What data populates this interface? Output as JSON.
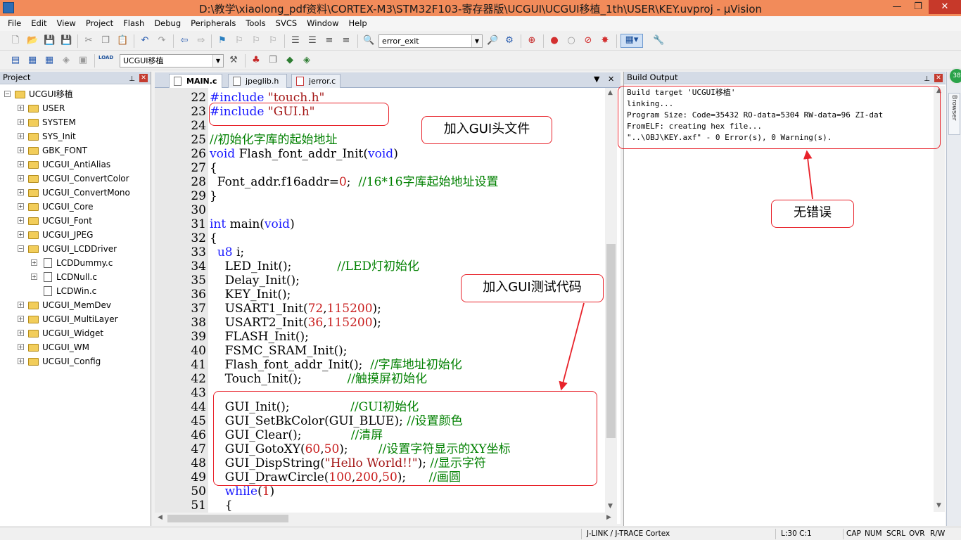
{
  "window": {
    "title": "D:\\教学\\xiaolong_pdf资料\\CORTEX-M3\\STM32F103-寄存器版\\UCGUI\\UCGUI移植_1th\\USER\\KEY.uvproj - µVision",
    "minimize": "—",
    "maximize": "❐",
    "close": "✕"
  },
  "menu": [
    "File",
    "Edit",
    "View",
    "Project",
    "Flash",
    "Debug",
    "Peripherals",
    "Tools",
    "SVCS",
    "Window",
    "Help"
  ],
  "toolbar": {
    "find_value": "error_exit",
    "target_value": "UCGUI移植",
    "load_label": "LOAD"
  },
  "project": {
    "header": "Project",
    "pin": "⊥",
    "close": "✕",
    "root": "UCGUI移植",
    "items": [
      {
        "label": "USER",
        "depth": 1,
        "kind": "folder"
      },
      {
        "label": "SYSTEM",
        "depth": 1,
        "kind": "folder"
      },
      {
        "label": "SYS_Init",
        "depth": 1,
        "kind": "folder"
      },
      {
        "label": "GBK_FONT",
        "depth": 1,
        "kind": "folder"
      },
      {
        "label": "UCGUI_AntiAlias",
        "depth": 1,
        "kind": "folder"
      },
      {
        "label": "UCGUI_ConvertColor",
        "depth": 1,
        "kind": "folder"
      },
      {
        "label": "UCGUI_ConvertMono",
        "depth": 1,
        "kind": "folder"
      },
      {
        "label": "UCGUI_Core",
        "depth": 1,
        "kind": "folder"
      },
      {
        "label": "UCGUI_Font",
        "depth": 1,
        "kind": "folder"
      },
      {
        "label": "UCGUI_JPEG",
        "depth": 1,
        "kind": "folder"
      },
      {
        "label": "UCGUI_LCDDriver",
        "depth": 1,
        "kind": "folder-open"
      },
      {
        "label": "LCDDummy.c",
        "depth": 2,
        "kind": "file"
      },
      {
        "label": "LCDNull.c",
        "depth": 2,
        "kind": "file"
      },
      {
        "label": "LCDWin.c",
        "depth": 2,
        "kind": "file"
      },
      {
        "label": "UCGUI_MemDev",
        "depth": 1,
        "kind": "folder"
      },
      {
        "label": "UCGUI_MultiLayer",
        "depth": 1,
        "kind": "folder"
      },
      {
        "label": "UCGUI_Widget",
        "depth": 1,
        "kind": "folder"
      },
      {
        "label": "UCGUI_WM",
        "depth": 1,
        "kind": "folder"
      },
      {
        "label": "UCGUI_Config",
        "depth": 1,
        "kind": "folder"
      }
    ]
  },
  "editor": {
    "tabs": [
      "MAIN.c",
      "jpeglib.h",
      "jerror.c"
    ],
    "tab_menu": "▼",
    "tab_close": "✕",
    "lines": [
      {
        "n": "22",
        "t": "#include \"touch.h\""
      },
      {
        "n": "23",
        "t": "#include \"GUI.h\""
      },
      {
        "n": "24",
        "t": ""
      },
      {
        "n": "25",
        "t": "//初始化字库的起始地址"
      },
      {
        "n": "26",
        "t": "void Flash_font_addr_Init(void)"
      },
      {
        "n": "27",
        "t": "{"
      },
      {
        "n": "28",
        "t": "  Font_addr.f16addr=0;  //16*16字库起始地址设置"
      },
      {
        "n": "29",
        "t": "}"
      },
      {
        "n": "30",
        "t": ""
      },
      {
        "n": "31",
        "t": "int main(void)"
      },
      {
        "n": "32",
        "t": "{"
      },
      {
        "n": "33",
        "t": "  u8 i;"
      },
      {
        "n": "34",
        "t": "    LED_Init();            //LED灯初始化"
      },
      {
        "n": "35",
        "t": "    Delay_Init();"
      },
      {
        "n": "36",
        "t": "    KEY_Init();"
      },
      {
        "n": "37",
        "t": "    USART1_Init(72,115200);"
      },
      {
        "n": "38",
        "t": "    USART2_Init(36,115200);"
      },
      {
        "n": "39",
        "t": "    FLASH_Init();"
      },
      {
        "n": "40",
        "t": "    FSMC_SRAM_Init();"
      },
      {
        "n": "41",
        "t": "    Flash_font_addr_Init();  //字库地址初始化"
      },
      {
        "n": "42",
        "t": "    Touch_Init();            //触摸屏初始化"
      },
      {
        "n": "43",
        "t": ""
      },
      {
        "n": "44",
        "t": "    GUI_Init();                //GUI初始化"
      },
      {
        "n": "45",
        "t": "    GUI_SetBkColor(GUI_BLUE); //设置颜色"
      },
      {
        "n": "46",
        "t": "    GUI_Clear();             //清屏"
      },
      {
        "n": "47",
        "t": "    GUI_GotoXY(60,50);        //设置字符显示的XY坐标"
      },
      {
        "n": "48",
        "t": "    GUI_DispString(\"Hello World!!\"); //显示字符"
      },
      {
        "n": "49",
        "t": "    GUI_DrawCircle(100,200,50);      //画圆"
      },
      {
        "n": "50",
        "t": "    while(1)"
      },
      {
        "n": "51",
        "t": "    {"
      }
    ]
  },
  "build": {
    "header": "Build Output",
    "pin": "⊥",
    "close": "✕",
    "lines": [
      "Build target 'UCGUI移植'",
      "linking...",
      "Program Size: Code=35432 RO-data=5304 RW-data=96 ZI-dat",
      "FromELF: creating hex file...",
      "\"..\\OBJ\\KEY.axf\" - 0 Error(s), 0 Warning(s)."
    ],
    "side_tab": "Browser",
    "badge": "38"
  },
  "status": {
    "debugger": "J-LINK / J-TRACE Cortex",
    "cursor": "L:30 C:1",
    "caps": "CAP",
    "num": "NUM",
    "scrl": "SCRL",
    "ovr": "OVR",
    "rw": "R/W"
  },
  "annotations": {
    "header_note": "加入GUI头文件",
    "code_note": "加入GUI测试代码",
    "result_note": "无错误"
  },
  "colors": {
    "title_bar": "#f28b5a",
    "annotation_red": "#e8222a",
    "keyword": "#1a1aff",
    "comment": "#008000",
    "string": "#a31515"
  }
}
